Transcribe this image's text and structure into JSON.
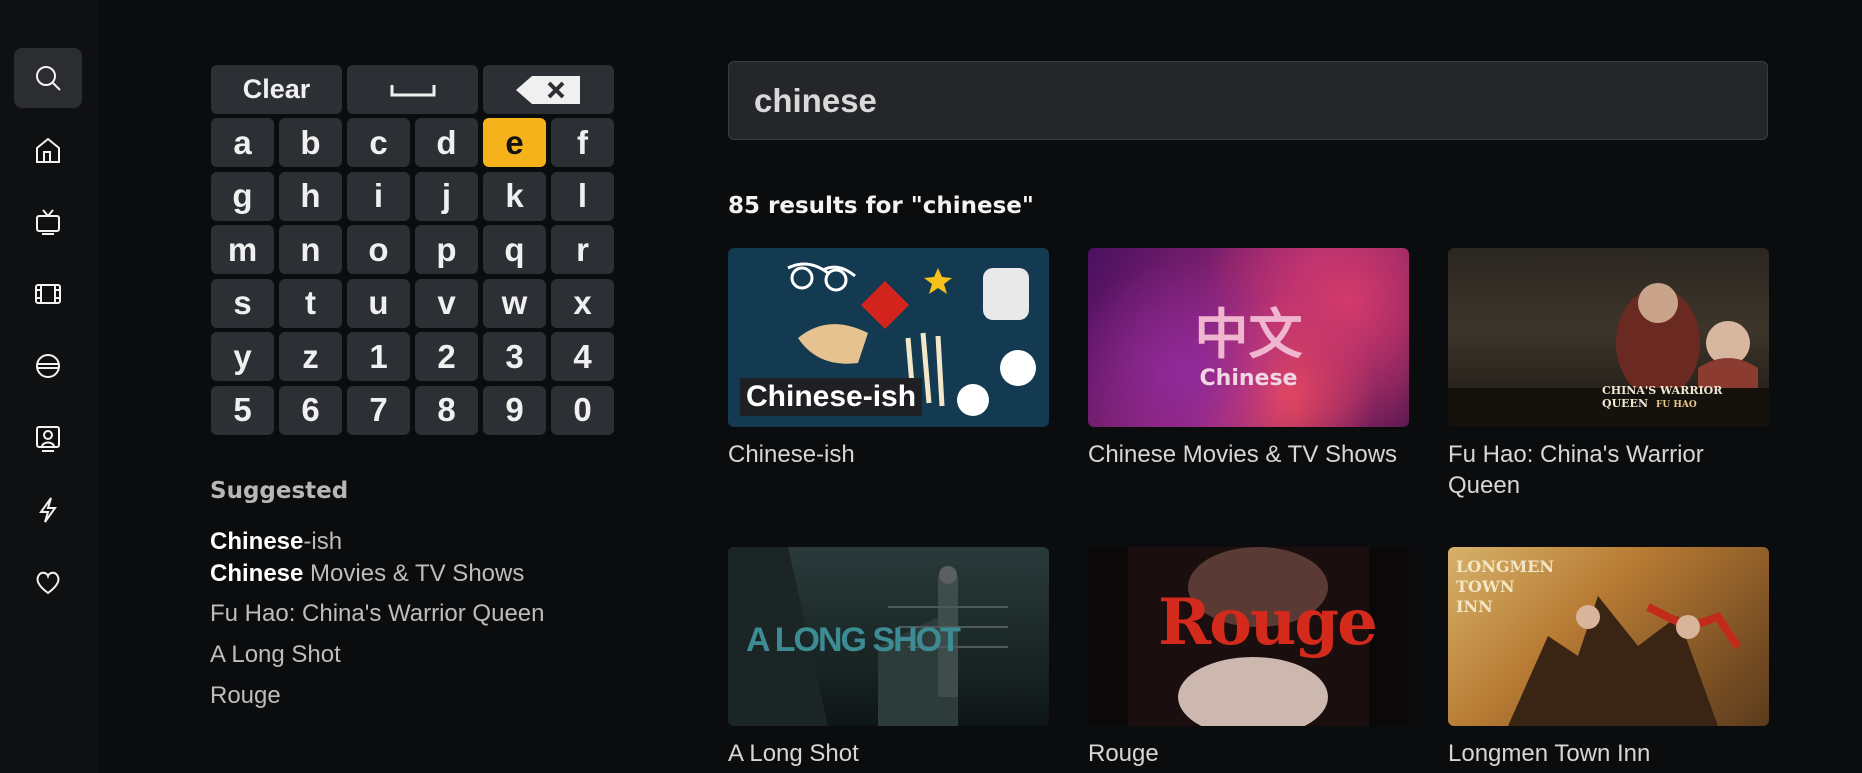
{
  "sidebar": {
    "items": [
      {
        "name": "search-icon",
        "active": true
      },
      {
        "name": "home-icon",
        "active": false
      },
      {
        "name": "tv-icon",
        "active": false
      },
      {
        "name": "film-icon",
        "active": false
      },
      {
        "name": "sports-ball-icon",
        "active": false
      },
      {
        "name": "profile-card-icon",
        "active": false
      },
      {
        "name": "lightning-icon",
        "active": false
      },
      {
        "name": "heart-icon",
        "active": false
      }
    ]
  },
  "keyboard": {
    "clear_label": "Clear",
    "space_icon": "space-bar-icon",
    "backspace_icon": "backspace-icon",
    "keys": [
      "a",
      "b",
      "c",
      "d",
      "e",
      "f",
      "g",
      "h",
      "i",
      "j",
      "k",
      "l",
      "m",
      "n",
      "o",
      "p",
      "q",
      "r",
      "s",
      "t",
      "u",
      "v",
      "w",
      "x",
      "y",
      "z",
      "1",
      "2",
      "3",
      "4",
      "5",
      "6",
      "7",
      "8",
      "9",
      "0"
    ],
    "focused_key": "e",
    "focus_color": "#f5b21b"
  },
  "suggested": {
    "title": "Suggested",
    "items": [
      {
        "bold": "Chinese",
        "rest": "-ish"
      },
      {
        "bold": "Chinese",
        "rest": " Movies & TV Shows"
      },
      {
        "bold": "",
        "rest": "Fu Hao: China's Warrior Queen"
      },
      {
        "bold": "",
        "rest": "A Long Shot"
      },
      {
        "bold": "",
        "rest": "Rouge"
      }
    ]
  },
  "search": {
    "query": "chinese"
  },
  "results": {
    "count_text": "85 results for \"chinese\"",
    "items": [
      {
        "title": "Chinese-ish",
        "thumb_text": "Chinese-ish"
      },
      {
        "title": "Chinese Movies & TV Shows",
        "thumb_text": "Chinese",
        "thumb_glyphs": "中文"
      },
      {
        "title": "Fu Hao: China's Warrior Queen",
        "thumb_text": "CHINA'S WARRIOR QUEEN",
        "thumb_sub": "FU HAO"
      },
      {
        "title": "A Long Shot",
        "thumb_text": "A LONG SHOT"
      },
      {
        "title": "Rouge",
        "thumb_text": "Rouge"
      },
      {
        "title": "Longmen Town Inn",
        "thumb_text": "LONGMEN TOWN INN"
      }
    ]
  }
}
